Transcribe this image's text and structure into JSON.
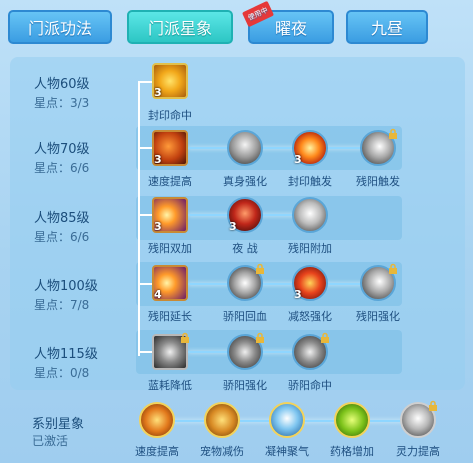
{
  "tabs": [
    {
      "label": "门派功法"
    },
    {
      "label": "门派星象"
    },
    {
      "label": "曜夜",
      "badge": "使用中"
    },
    {
      "label": "九昼"
    }
  ],
  "rows": [
    {
      "level": "人物60级",
      "stars": "星点：3/3"
    },
    {
      "level": "人物70级",
      "stars": "星点：6/6"
    },
    {
      "level": "人物85级",
      "stars": "星点：6/6"
    },
    {
      "level": "人物100级",
      "stars": "星点：7/8"
    },
    {
      "level": "人物115级",
      "stars": "星点：0/8"
    }
  ],
  "skills": {
    "r1": [
      {
        "label": "封印命中",
        "count": "3"
      }
    ],
    "r2": [
      {
        "label": "速度提高",
        "count": "3"
      },
      {
        "label": "真身强化",
        "count": ""
      },
      {
        "label": "封印触发",
        "count": "3"
      },
      {
        "label": "残阳触发",
        "count": ""
      }
    ],
    "r3": [
      {
        "label": "残阳双加",
        "count": "3"
      },
      {
        "label": "夜 战",
        "count": "3"
      },
      {
        "label": "残阳附加",
        "count": ""
      }
    ],
    "r4": [
      {
        "label": "残阳延长",
        "count": "4"
      },
      {
        "label": "骄阳回血",
        "count": ""
      },
      {
        "label": "减怒强化",
        "count": "3"
      },
      {
        "label": "残阳强化",
        "count": ""
      }
    ],
    "r5": [
      {
        "label": "蓝耗降低",
        "count": ""
      },
      {
        "label": "骄阳强化",
        "count": ""
      },
      {
        "label": "骄阳命中",
        "count": ""
      }
    ]
  },
  "series": {
    "title": "系别星象",
    "status": "已激活",
    "items": [
      {
        "label": "速度提高"
      },
      {
        "label": "宠物减伤"
      },
      {
        "label": "凝神聚气"
      },
      {
        "label": "药格增加"
      },
      {
        "label": "灵力提高"
      }
    ]
  }
}
